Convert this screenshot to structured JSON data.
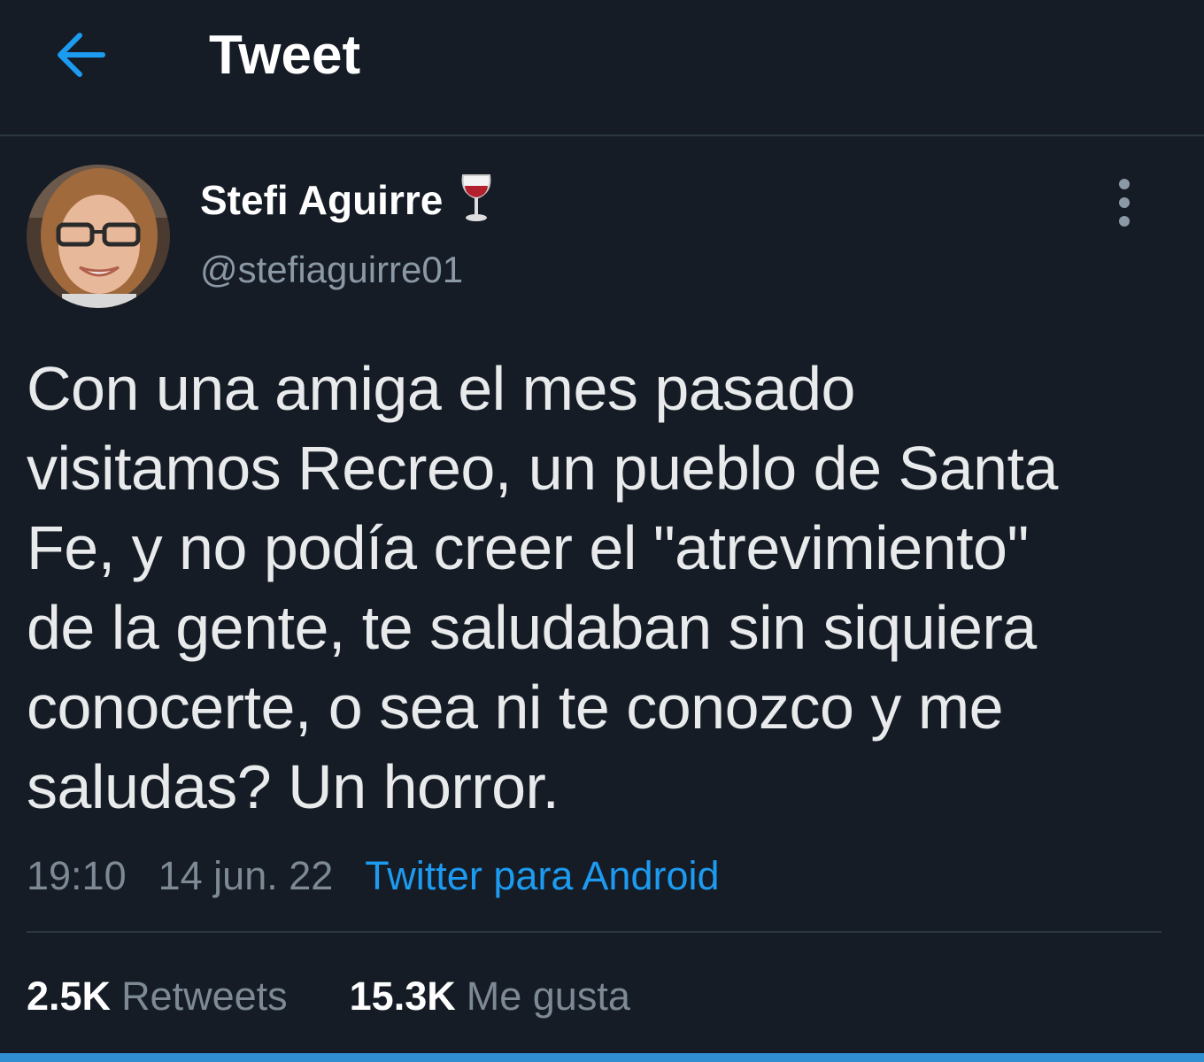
{
  "header": {
    "title": "Tweet",
    "back_icon": "arrow-left-icon"
  },
  "author": {
    "display_name": "Stefi Aguirre",
    "name_emoji": "🍷",
    "handle": "@stefiaguirre01",
    "avatar_icon": "avatar"
  },
  "tweet": {
    "lines": [
      "Con una amiga el mes pasado",
      "visitamos Recreo, un pueblo de Santa",
      "Fe, y no podía creer el \"atrevimiento\"",
      "de la gente, te saludaban sin siquiera",
      "conocerte, o sea ni te conozco y me",
      "saludas? Un horror."
    ],
    "time": "19:10",
    "date": "14 jun. 22",
    "source": "Twitter para Android"
  },
  "stats": {
    "retweets_count": "2.5K",
    "retweets_label": "Retweets",
    "likes_count": "15.3K",
    "likes_label": "Me gusta"
  },
  "colors": {
    "background": "#151c26",
    "accent": "#1d9bf0",
    "secondary_text": "#7d8994"
  }
}
